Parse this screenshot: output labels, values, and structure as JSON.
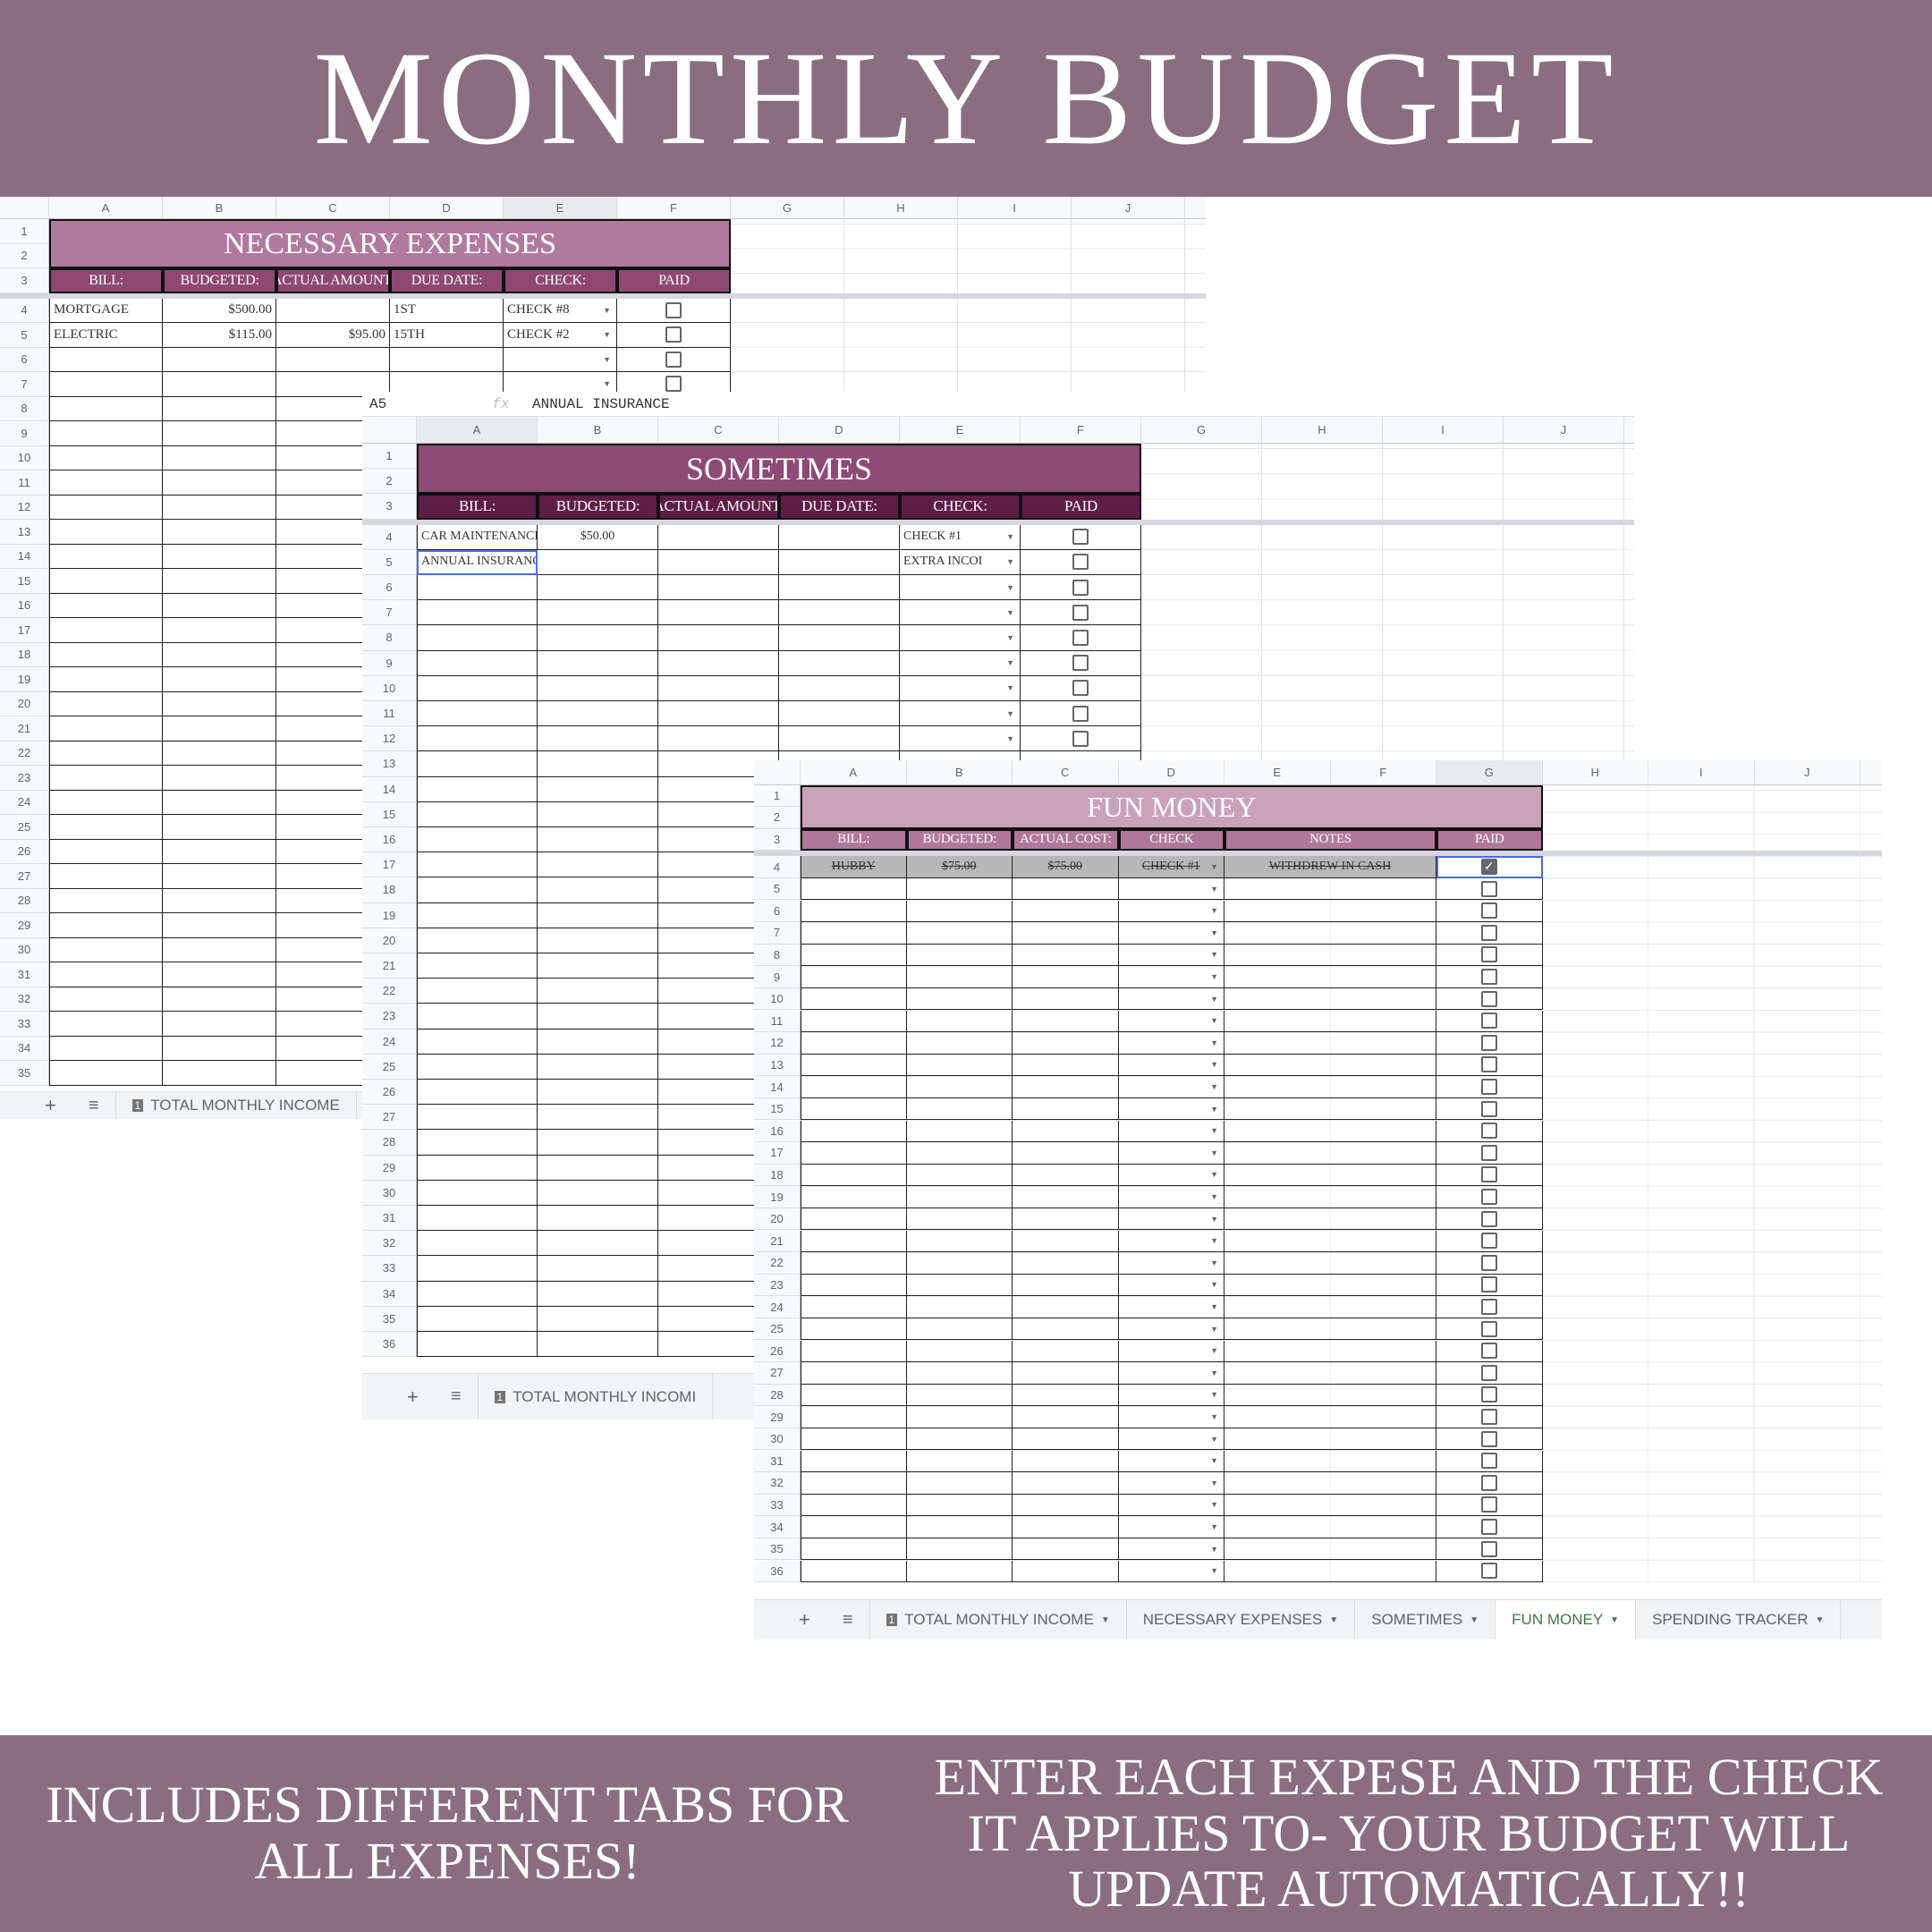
{
  "banner": {
    "title": "MONTHLY BUDGET"
  },
  "footer": {
    "left": "INCLUDES DIFFERENT TABS FOR ALL EXPENSES!",
    "right": "ENTER EACH EXPESE AND THE CHECK IT APPLIES TO- YOUR BUDGET WILL UPDATE AUTOMATICALLY!!"
  },
  "colors": {
    "banner": "#8a6e80",
    "necessary_title": "#b07a9e",
    "necessary_header": "#8e4872",
    "sometimes_title": "#8e4a76",
    "sometimes_header": "#5e1e48",
    "fun_title": "#c9a2b9",
    "fun_header": "#b07898",
    "active_tab": "#3d7a3d"
  },
  "sheets": [
    {
      "columns": [
        "A",
        "B",
        "C",
        "D",
        "E",
        "F",
        "G",
        "H",
        "I",
        "J"
      ],
      "selected_column": "E",
      "row_count": 35,
      "title": "NECESSARY EXPENSES",
      "headers": [
        "BILL:",
        "BUDGETED:",
        "ACTUAL AMOUNT:",
        "DUE DATE:",
        "CHECK:",
        "PAID"
      ],
      "rows": [
        [
          "MORTGAGE",
          "$500.00",
          "",
          "1ST",
          "CHECK #8",
          false
        ],
        [
          "ELECTRIC",
          "$115.00",
          "$95.00",
          "15TH",
          "CHECK #2",
          false
        ],
        [
          "",
          "",
          "",
          "",
          "",
          false
        ],
        [
          "",
          "",
          "",
          "",
          "",
          false
        ]
      ],
      "tabs": [
        {
          "label": "TOTAL MONTHLY INCOME",
          "badge": "1"
        }
      ]
    },
    {
      "formula_bar": {
        "cell_ref": "A5",
        "fx": "fx",
        "value": "ANNUAL  INSURANCE"
      },
      "columns": [
        "A",
        "B",
        "C",
        "D",
        "E",
        "F",
        "G",
        "H",
        "I",
        "J"
      ],
      "selected_column": "A",
      "row_count": 36,
      "title": "SOMETIMES",
      "headers": [
        "BILL:",
        "BUDGETED:",
        "ACTUAL AMOUNT:",
        "DUE DATE:",
        "CHECK:",
        "PAID"
      ],
      "rows": [
        [
          "CAR MAINTENANCE",
          "$50.00",
          "",
          "",
          "CHECK #1",
          false
        ],
        [
          "ANNUAL INSURANCE",
          "",
          "",
          "",
          "EXTRA INCOI",
          false
        ],
        [
          "",
          "",
          "",
          "",
          "",
          false
        ],
        [
          "",
          "",
          "",
          "",
          "",
          false
        ],
        [
          "",
          "",
          "",
          "",
          "",
          false
        ],
        [
          "",
          "",
          "",
          "",
          "",
          false
        ],
        [
          "",
          "",
          "",
          "",
          "",
          false
        ],
        [
          "",
          "",
          "",
          "",
          "",
          false
        ],
        [
          "",
          "",
          "",
          "",
          "",
          false
        ]
      ],
      "tabs": [
        {
          "label": "TOTAL MONTHLY INCOMI",
          "badge": "1"
        }
      ]
    },
    {
      "columns": [
        "A",
        "B",
        "C",
        "D",
        "E",
        "F",
        "G",
        "H",
        "I",
        "J"
      ],
      "selected_column": "G",
      "row_count": 36,
      "title": "FUN MONEY",
      "headers": [
        "BILL:",
        "BUDGETED:",
        "ACTUAL COST:",
        "CHECK",
        "NOTES",
        "PAID"
      ],
      "rows": [
        [
          "HUBBY",
          "$75.00",
          "$75.00",
          "CHECK #1",
          "WITHDREW IN CASH",
          true
        ]
      ],
      "tabs": [
        {
          "label": "TOTAL MONTHLY INCOME",
          "badge": "1"
        },
        {
          "label": "NECESSARY EXPENSES"
        },
        {
          "label": "SOMETIMES"
        },
        {
          "label": "FUN MONEY",
          "active": true
        },
        {
          "label": "SPENDING TRACKER"
        }
      ]
    }
  ]
}
